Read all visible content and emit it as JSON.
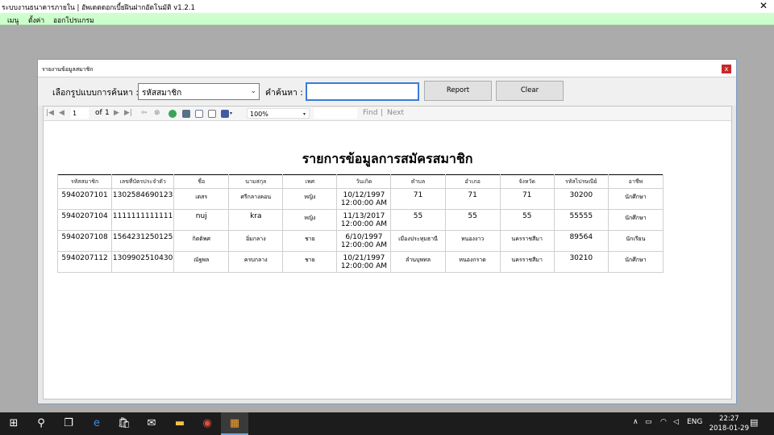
{
  "window": {
    "title": "ระบบงานธนาคารภายใน | อัพเดตดอกเบี้ยฝินฝากอัตโนมัติ   v1.2.1",
    "close_glyph": "✕"
  },
  "menu": [
    "เมนู",
    "ตั้งค่า",
    "ออกโปรแกรม"
  ],
  "child_window": {
    "title": "รายงานข้อมูลสมาชิก",
    "close_glyph": "x"
  },
  "search": {
    "mode_label": "เลือกรูปแบบการค้นหา :",
    "mode_value": "รหัสสมาชิก",
    "keyword_label": "คำค้นหา :",
    "keyword_value": "",
    "report_button": "Report",
    "clear_button": "Clear"
  },
  "viewer_toolbar": {
    "page": "1",
    "of_label": "of",
    "total_pages": "1",
    "zoom": "100%",
    "find_label": "Find",
    "next_label": "Next"
  },
  "report": {
    "title": "รายการข้อมูลการสมัครสมาชิก",
    "columns": [
      "รหัสสมาชิก",
      "เลขที่บัตรประจำตัว",
      "ชื่อ",
      "นามสกุล",
      "เพศ",
      "วันเกิด",
      "ตำบล",
      "อำเภอ",
      "จังหวัด",
      "รหัสไปรษณีย์",
      "อาชีพ"
    ],
    "rows": [
      [
        "5940207101",
        "1302584690123",
        "เตสร",
        "ศรีกลางคอน",
        "หญิง",
        "10/12/1997\n12:00:00 AM",
        "71",
        "71",
        "71",
        "30200",
        "นักศึกษา"
      ],
      [
        "5940207104",
        "1111111111111",
        "nuj",
        "kra",
        "หญิง",
        "11/13/2017\n12:00:00 AM",
        "55",
        "55",
        "55",
        "55555",
        "นักศึกษา"
      ],
      [
        "5940207108",
        "1564231250125",
        "กิตติพศ",
        "อิ่มกลาง",
        "ชาย",
        "6/10/1997\n12:00:00 AM",
        "เมืองประทุมธานี",
        "หนองงาว",
        "นครราชสีมา",
        "89564",
        "นักเรียน"
      ],
      [
        "5940207112",
        "1309902510430",
        "ณัฐพล",
        "ครบกลาง",
        "ชาย",
        "10/21/1997\n12:00:00 AM",
        "ลำนบุพทล",
        "หนองกราด",
        "นครราชสีมา",
        "30210",
        "นักศึกษา"
      ]
    ]
  },
  "taskbar": {
    "tray_lang": "ENG",
    "time": "22:27",
    "date": "2018-01-29"
  },
  "colors": {
    "menubar": "#ccffcc",
    "mdi_background": "#ababab",
    "input_focus": "#3a7cd6",
    "child_close": "#c62828"
  }
}
